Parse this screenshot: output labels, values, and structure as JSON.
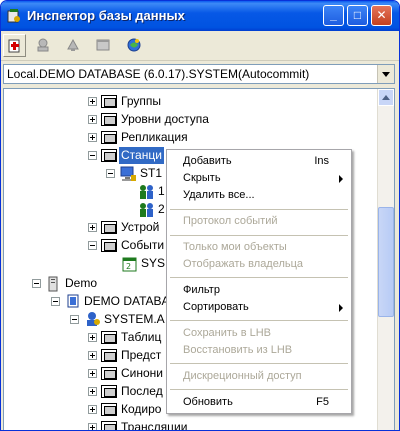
{
  "window": {
    "title": "Инспектор базы данных",
    "minimize": "_",
    "maximize": "□",
    "close": "✕"
  },
  "toolbar": {
    "icons": [
      "new-icon",
      "properties-icon",
      "bell-icon",
      "window-icon",
      "connect-icon"
    ]
  },
  "connection": {
    "selected": "Local.DEMO DATABASE (6.0.17).SYSTEM(Autocommit)"
  },
  "tree": {
    "items": [
      {
        "label": "Группы"
      },
      {
        "label": "Уровни доступа"
      },
      {
        "label": "Репликация"
      },
      {
        "label": "Станци"
      },
      {
        "label": "ST1"
      },
      {
        "label": "1"
      },
      {
        "label": "2"
      },
      {
        "label": "Устрой"
      },
      {
        "label": "Событи"
      },
      {
        "label": "SYS"
      },
      {
        "label": "Demo"
      },
      {
        "label": "DEMO DATABA"
      },
      {
        "label": "SYSTEM.A"
      },
      {
        "label": "Таблиц"
      },
      {
        "label": "Предст"
      },
      {
        "label": "Синони"
      },
      {
        "label": "Послед"
      },
      {
        "label": "Кодиро"
      },
      {
        "label": "Трансляции"
      }
    ]
  },
  "context_menu": {
    "items": [
      {
        "label": "Добавить",
        "shortcut": "Ins"
      },
      {
        "label": "Скрыть"
      },
      {
        "label": "Удалить все..."
      },
      {
        "label": "Протокол событий"
      },
      {
        "label": "Только мои объекты"
      },
      {
        "label": "Отображать владельца"
      },
      {
        "label": "Фильтр"
      },
      {
        "label": "Сортировать"
      },
      {
        "label": "Сохранить в LHB"
      },
      {
        "label": "Восстановить из LHB"
      },
      {
        "label": "Дискреционный доступ"
      },
      {
        "label": "Обновить",
        "shortcut": "F5"
      }
    ]
  }
}
